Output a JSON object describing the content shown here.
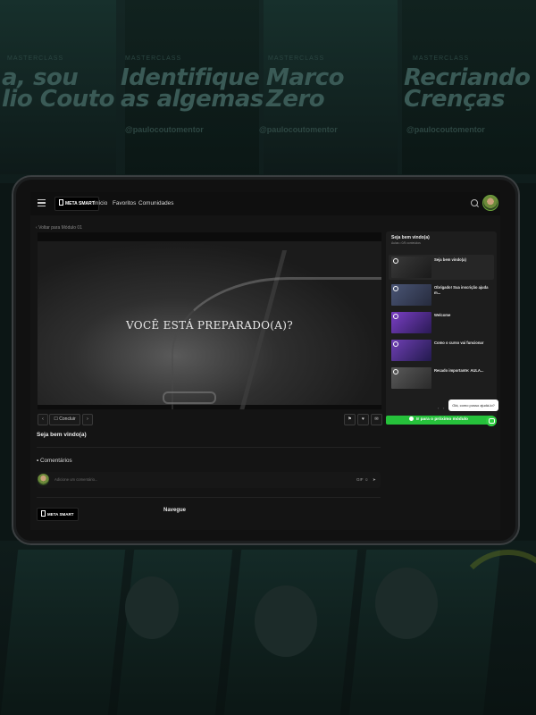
{
  "background": {
    "kicker": "MASTERCLASS",
    "titles": [
      {
        "line1": "a, sou",
        "line2": "lio Couto"
      },
      {
        "line1": "Identifique",
        "line2": "as algemas"
      },
      {
        "line1": "Marco",
        "line2": "Zero"
      },
      {
        "line1": "Recriando",
        "line2": "Crenças"
      }
    ],
    "handle": "@paulocoutomentor"
  },
  "nav": {
    "brand": "META SMART",
    "links": [
      "Início",
      "Favoritos",
      "Comunidades"
    ]
  },
  "breadcrumb": "Voltar para Módulo 01",
  "video": {
    "caption": "VOCÊ ESTÁ PREPARADO(A)?"
  },
  "controls": {
    "prev": "‹",
    "complete": "Concluir",
    "next": "›",
    "icons": [
      "flag-icon",
      "like-icon",
      "comment-icon"
    ]
  },
  "lesson": {
    "title": "Seja bem vindo(a)"
  },
  "comments": {
    "heading": "Comentários",
    "placeholder": "Adicione um comentário...",
    "gif_label": "GIF"
  },
  "sidebar": {
    "title": "Seja bem vindo(a)",
    "subtitle": "Aulas • 0/5 conteúdos",
    "items": [
      {
        "label": "Seja bem vindo(a)",
        "thumb": "#2b2b2b",
        "active": true
      },
      {
        "label": "Obrigado! Sua inscrição ajuda m...",
        "thumb": "#38405a",
        "active": false
      },
      {
        "label": "Welcome",
        "thumb": "#4a2f7a",
        "active": false
      },
      {
        "label": "Como o curso vai funcionar",
        "thumb": "#3f2f6f",
        "active": false
      },
      {
        "label": "Recado importante: AULA...",
        "thumb": "#3a3a3a",
        "active": false
      }
    ],
    "next_button": "Ir para o próximo módulo"
  },
  "chat": {
    "bubble": "Olá, como posso ajudá-lo?"
  },
  "footer": {
    "brand": "META SMART",
    "navegue": "Navegue"
  },
  "colors": {
    "accent_green": "#26c13b",
    "panel_bg": "#1d1d1d",
    "screen_bg": "#141414"
  }
}
